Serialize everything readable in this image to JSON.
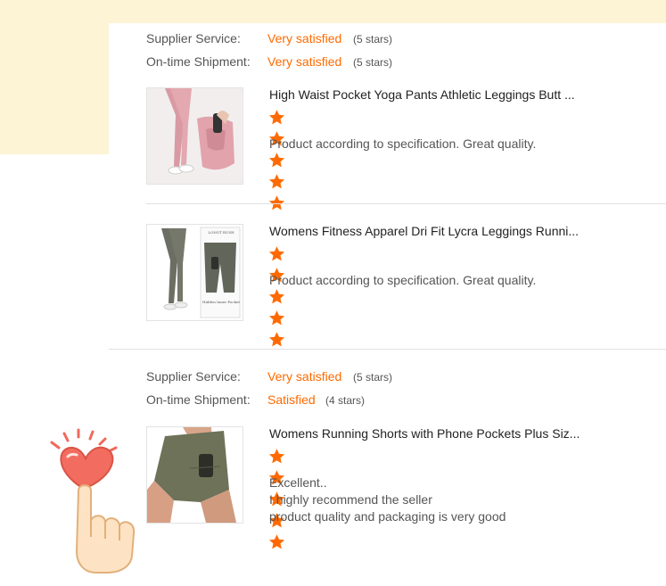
{
  "reviews": [
    {
      "supplier_service_label": "Supplier Service:",
      "supplier_service_value": "Very satisfied",
      "supplier_service_stars": "(5 stars)",
      "shipment_label": "On-time Shipment:",
      "shipment_value": "Very satisfied",
      "shipment_stars": "(5 stars)",
      "products": [
        {
          "title": "High Waist Pocket Yoga Pants Athletic Leggings Butt ...",
          "rating": 5,
          "review_lines": [
            "Product according to specification. Great quality."
          ]
        },
        {
          "title": "Womens Fitness Apparel Dri Fit Lycra Leggings Runni...",
          "thumb_text": [
            "LONGT RUSH",
            "Hidden Inner Pocket"
          ],
          "rating": 5,
          "review_lines": [
            "Product according to specification. Great quality."
          ]
        }
      ]
    },
    {
      "supplier_service_label": "Supplier Service:",
      "supplier_service_value": "Very satisfied",
      "supplier_service_stars": "(5 stars)",
      "shipment_label": "On-time Shipment:",
      "shipment_value": "Satisfied",
      "shipment_stars": "(4 stars)",
      "products": [
        {
          "title": "Womens Running Shorts with Phone Pockets Plus Siz...",
          "rating": 5,
          "review_lines": [
            "Excellent..",
            "I highly recommend the seller",
            "product quality and packaging is very good"
          ]
        }
      ]
    }
  ],
  "colors": {
    "accent": "#ff6a00",
    "background_banner": "#fdf3d5",
    "heart": "#f0695c"
  },
  "icons": [
    "star-icon",
    "heart-hand-sticker"
  ]
}
